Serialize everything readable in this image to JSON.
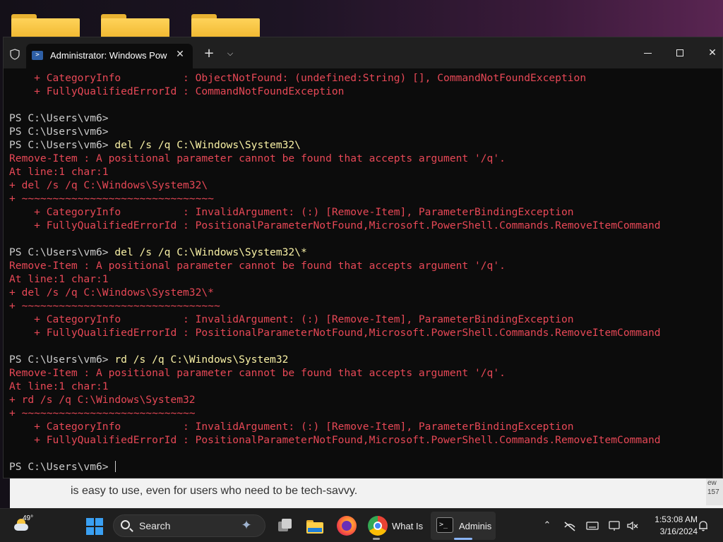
{
  "window": {
    "tab_title": "Administrator: Windows PowerShell",
    "tab_close_glyph": "✕",
    "new_tab_glyph": "+",
    "tab_dropdown_glyph": "⌵",
    "minimize_label": "",
    "close_glyph": "✕"
  },
  "console": {
    "lines": [
      {
        "type": "err",
        "text": "    + CategoryInfo          : ObjectNotFound: (undefined:String) [], CommandNotFoundException"
      },
      {
        "type": "err",
        "text": "    + FullyQualifiedErrorId : CommandNotFoundException"
      },
      {
        "type": "blank",
        "text": ""
      },
      {
        "type": "prompt",
        "prompt": "PS C:\\Users\\vm6>",
        "command": ""
      },
      {
        "type": "prompt",
        "prompt": "PS C:\\Users\\vm6>",
        "command": ""
      },
      {
        "type": "prompt",
        "prompt": "PS C:\\Users\\vm6>",
        "command": " del /s /q C:\\Windows\\System32\\"
      },
      {
        "type": "err",
        "text": "Remove-Item : A positional parameter cannot be found that accepts argument '/q'."
      },
      {
        "type": "err",
        "text": "At line:1 char:1"
      },
      {
        "type": "err",
        "text": "+ del /s /q C:\\Windows\\System32\\"
      },
      {
        "type": "err",
        "text": "+ ~~~~~~~~~~~~~~~~~~~~~~~~~~~~~~~"
      },
      {
        "type": "err",
        "text": "    + CategoryInfo          : InvalidArgument: (:) [Remove-Item], ParameterBindingException"
      },
      {
        "type": "err",
        "text": "    + FullyQualifiedErrorId : PositionalParameterNotFound,Microsoft.PowerShell.Commands.RemoveItemCommand"
      },
      {
        "type": "blank",
        "text": ""
      },
      {
        "type": "prompt",
        "prompt": "PS C:\\Users\\vm6>",
        "command": " del /s /q C:\\Windows\\System32\\*"
      },
      {
        "type": "err",
        "text": "Remove-Item : A positional parameter cannot be found that accepts argument '/q'."
      },
      {
        "type": "err",
        "text": "At line:1 char:1"
      },
      {
        "type": "err",
        "text": "+ del /s /q C:\\Windows\\System32\\*"
      },
      {
        "type": "err",
        "text": "+ ~~~~~~~~~~~~~~~~~~~~~~~~~~~~~~~~"
      },
      {
        "type": "err",
        "text": "    + CategoryInfo          : InvalidArgument: (:) [Remove-Item], ParameterBindingException"
      },
      {
        "type": "err",
        "text": "    + FullyQualifiedErrorId : PositionalParameterNotFound,Microsoft.PowerShell.Commands.RemoveItemCommand"
      },
      {
        "type": "blank",
        "text": ""
      },
      {
        "type": "prompt",
        "prompt": "PS C:\\Users\\vm6>",
        "command": " rd /s /q C:\\Windows\\System32"
      },
      {
        "type": "err",
        "text": "Remove-Item : A positional parameter cannot be found that accepts argument '/q'."
      },
      {
        "type": "err",
        "text": "At line:1 char:1"
      },
      {
        "type": "err",
        "text": "+ rd /s /q C:\\Windows\\System32"
      },
      {
        "type": "err",
        "text": "+ ~~~~~~~~~~~~~~~~~~~~~~~~~~~~"
      },
      {
        "type": "err",
        "text": "    + CategoryInfo          : InvalidArgument: (:) [Remove-Item], ParameterBindingException"
      },
      {
        "type": "err",
        "text": "    + FullyQualifiedErrorId : PositionalParameterNotFound,Microsoft.PowerShell.Commands.RemoveItemCommand"
      },
      {
        "type": "blank",
        "text": ""
      },
      {
        "type": "prompt",
        "prompt": "PS C:\\Users\\vm6>",
        "command": " ",
        "cursor": true
      }
    ]
  },
  "background_window": {
    "text": "is easy to use, even for users who need to be tech-savvy.",
    "side_line1": "ew",
    "side_line2": "157"
  },
  "taskbar": {
    "weather_temp": "49°",
    "search_label": "Search",
    "chrome_label": "What Is",
    "terminal_label": "Adminis",
    "time": "1:53:08 AM",
    "date": "3/16/2024",
    "tray_chevron": "⌃",
    "term_icon_glyph": ">_"
  },
  "colors": {
    "console_bg": "#0c0c0c",
    "prompt": "#cccccc",
    "command": "#f9f1a5",
    "error": "#e74856",
    "taskbar_bg": "#1f1f1f",
    "titlebar_bg": "#202020"
  }
}
